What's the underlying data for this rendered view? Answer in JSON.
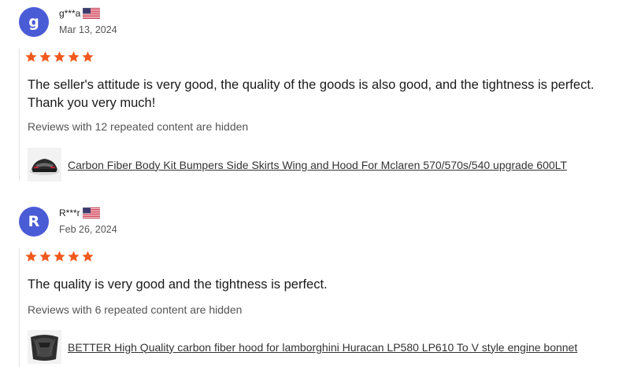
{
  "colors": {
    "avatar_bg": "#4a5bd6",
    "star": "#f05a1e",
    "rule": "#e3e3e3"
  },
  "reviews": [
    {
      "avatar_letter": "g",
      "username": "g***a",
      "country_flag": "us-flag-icon",
      "date": "Mar 13, 2024",
      "rating": 5,
      "text": "The seller's attitude is very good, the quality of the goods is also good, and the tightness is perfect. Thank you very much!",
      "hidden_note": "Reviews with 12 repeated content are hidden",
      "product_title": "Carbon Fiber Body Kit Bumpers Side Skirts Wing and Hood For Mclaren 570/570s/540 upgrade 600LT",
      "product_thumb": "car-rear-thumbnail-icon"
    },
    {
      "avatar_letter": "R",
      "username": "R***r",
      "country_flag": "us-flag-icon",
      "date": "Feb 26, 2024",
      "rating": 5,
      "text": "The quality is very good and the tightness is perfect.",
      "hidden_note": "Reviews with 6 repeated content are hidden",
      "product_title": "BETTER High Quality carbon fiber hood for lamborghini Huracan LP580 LP610 To V style engine bonnet",
      "product_thumb": "carbon-hood-thumbnail-icon"
    }
  ]
}
